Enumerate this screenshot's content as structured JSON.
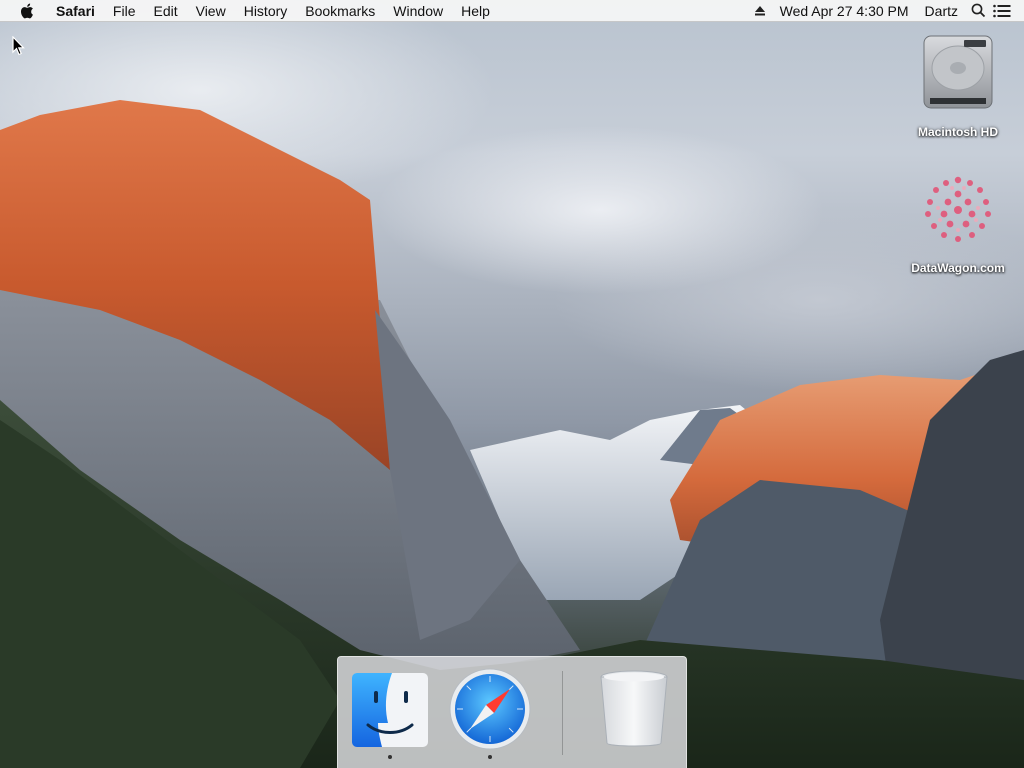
{
  "menubar": {
    "app_name": "Safari",
    "menus": [
      "File",
      "Edit",
      "View",
      "History",
      "Bookmarks",
      "Window",
      "Help"
    ],
    "clock": "Wed Apr 27  4:30 PM",
    "user": "Dartz"
  },
  "desktop_icons": [
    {
      "label": "Macintosh HD",
      "icon": "hard-drive-icon"
    },
    {
      "label": "DataWagon.com",
      "icon": "datawagon-logo-icon"
    }
  ],
  "dock": {
    "items": [
      {
        "name": "Finder",
        "icon": "finder-icon",
        "running": true
      },
      {
        "name": "Safari",
        "icon": "safari-icon",
        "running": true
      },
      {
        "name": "Trash",
        "icon": "trash-icon",
        "running": false
      }
    ]
  },
  "colors": {
    "menubar_bg": "#f5f5f5",
    "finder_blue": "#1e7ff0",
    "safari_blue": "#1a8df2"
  }
}
